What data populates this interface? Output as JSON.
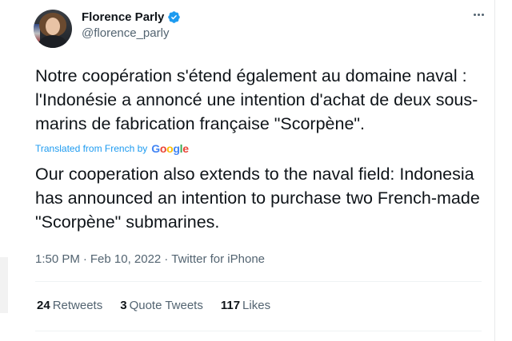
{
  "author": {
    "display_name": "Florence Parly",
    "handle": "@florence_parly",
    "verified": true,
    "verified_color": "#1d9bf0"
  },
  "tweet": {
    "text": "Notre coopération s'étend également au domaine naval : l'Indonésie a annoncé une intention d'achat de deux sous-marins de fabrication française \"Scorpène\".",
    "translation_label": "Translated from French by",
    "translation_provider": "Google",
    "translation": "Our cooperation also extends to the naval field: Indonesia has announced an intention to purchase two French-made \"Scorpène\" submarines.",
    "time": "1:50 PM",
    "separator": "·",
    "date": "Feb 10, 2022",
    "source": "Twitter for iPhone"
  },
  "stats": {
    "retweets_count": "24",
    "retweets_label": "Retweets",
    "quote_count": "3",
    "quote_label": "Quote Tweets",
    "likes_count": "117",
    "likes_label": "Likes"
  },
  "colors": {
    "text": "#0f1419",
    "secondary": "#536471",
    "link": "#1d9bf0",
    "divider": "#eff3f4"
  },
  "icons": [
    "verified-icon",
    "more-options-icon",
    "avatar"
  ]
}
